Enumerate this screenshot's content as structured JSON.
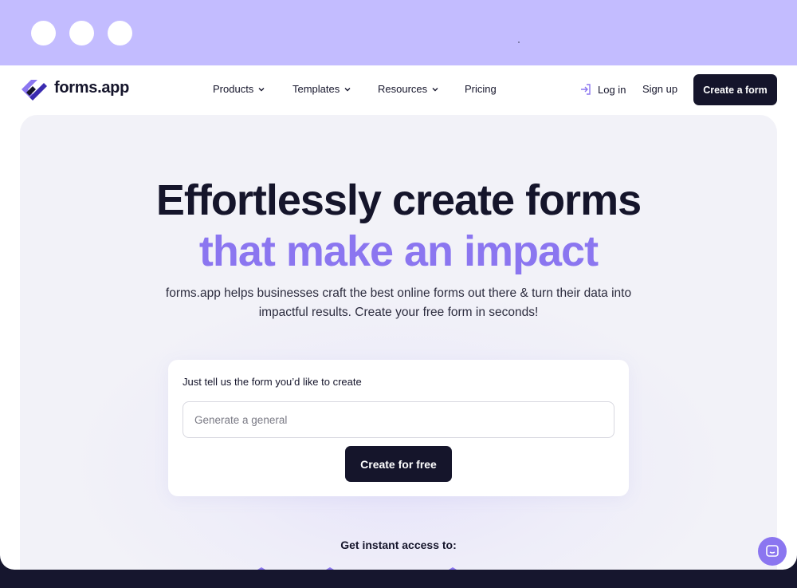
{
  "nav": {
    "brand": "forms.app",
    "items": [
      {
        "label": "Products"
      },
      {
        "label": "Templates"
      },
      {
        "label": "Resources"
      },
      {
        "label": "Pricing"
      }
    ],
    "login": "Log in",
    "signup": "Sign up",
    "cta": "Create a form"
  },
  "hero": {
    "title_line1": "Effortlessly create forms",
    "title_line2": "that make an impact",
    "subtitle": "forms.app helps businesses craft the best online forms out there & turn their data into impactful results. Create your free form in seconds!",
    "card": {
      "label": "Just tell us the form you’d like to create",
      "input_placeholder": "Generate a general",
      "button": "Create for free"
    },
    "instant_access": "Get instant access to:"
  },
  "colors": {
    "accent": "#8b76f0",
    "dark": "#15152b",
    "window_bar": "#c3bcff"
  },
  "icons": [
    "brand-logo-icon",
    "chevron-down-icon",
    "login-icon",
    "chat-icon"
  ]
}
